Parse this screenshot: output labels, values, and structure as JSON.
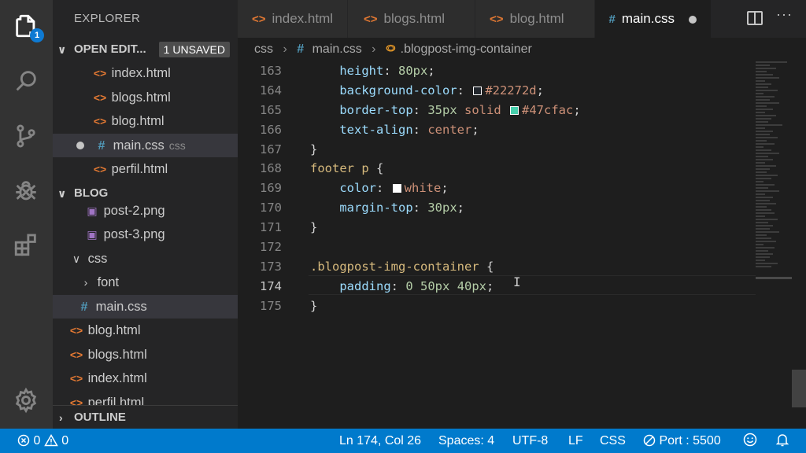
{
  "activity_bar": {
    "explorer_badge": "1"
  },
  "sidebar": {
    "title": "EXPLORER",
    "open_editors": {
      "label": "OPEN EDIT...",
      "unsaved": "1 UNSAVED",
      "items": [
        {
          "icon": "html-file-icon",
          "name": "index.html"
        },
        {
          "icon": "html-file-icon",
          "name": "blogs.html"
        },
        {
          "icon": "html-file-icon",
          "name": "blog.html"
        },
        {
          "icon": "css-file-icon",
          "name": "main.css",
          "folder": "css"
        },
        {
          "icon": "html-file-icon",
          "name": "perfil.html"
        }
      ]
    },
    "blog": {
      "label": "BLOG",
      "items": [
        {
          "icon": "image-file-icon",
          "name": "post-2.png"
        },
        {
          "icon": "image-file-icon",
          "name": "post-3.png"
        },
        {
          "icon": "folder-open-icon",
          "name": "css"
        },
        {
          "icon": "folder-closed-icon",
          "name": "font"
        },
        {
          "icon": "css-file-icon",
          "name": "main.css"
        },
        {
          "icon": "html-file-icon",
          "name": "blog.html"
        },
        {
          "icon": "html-file-icon",
          "name": "blogs.html"
        },
        {
          "icon": "html-file-icon",
          "name": "index.html"
        },
        {
          "icon": "html-file-icon",
          "name": "perfil.html"
        }
      ]
    },
    "outline": "OUTLINE"
  },
  "tabs": [
    {
      "name": "index.html",
      "icon": "html-file-icon"
    },
    {
      "name": "blogs.html",
      "icon": "html-file-icon"
    },
    {
      "name": "blog.html",
      "icon": "html-file-icon"
    },
    {
      "name": "main.css",
      "icon": "css-file-icon",
      "active": true
    }
  ],
  "breadcrumb": {
    "folder": "css",
    "file": "main.css",
    "symbol": ".blogpost-img-container"
  },
  "editor": {
    "line_numbers": [
      "163",
      "164",
      "165",
      "166",
      "167",
      "168",
      "169",
      "170",
      "171",
      "172",
      "173",
      "174",
      "175"
    ],
    "current_line": "174",
    "code": {
      "l163": {
        "prop": "height",
        "value": "80px"
      },
      "l164": {
        "prop": "background-color",
        "value": "#22272d"
      },
      "l165": {
        "prop": "border-top",
        "num": "35px",
        "kw": "solid",
        "value": "#47cfac"
      },
      "l166": {
        "prop": "text-align",
        "value": "center"
      },
      "l167": "}",
      "l168": {
        "selector": "footer p",
        "brace": "{"
      },
      "l169": {
        "prop": "color",
        "value": "white"
      },
      "l170": {
        "prop": "margin-top",
        "value": "30px"
      },
      "l171": "}",
      "l173": {
        "selector": ".blogpost-img-container",
        "brace": "{"
      },
      "l174": {
        "prop": "padding",
        "v1": "0",
        "v2": "50px",
        "v3": "40px"
      },
      "l175": "}"
    },
    "swatches": {
      "c164": "#22272d",
      "c165": "#47cfac",
      "c169": "#ffffff"
    }
  },
  "status_bar": {
    "errors": "0",
    "warnings": "0",
    "position": "Ln 174, Col 26",
    "spaces": "Spaces: 4",
    "encoding": "UTF-8",
    "eol": "LF",
    "language": "CSS",
    "port": "Port : 5500"
  },
  "colors": {
    "accent": "#007acc",
    "html_icon": "#e37933",
    "css_icon": "#519aba",
    "image_icon": "#a074c4"
  }
}
